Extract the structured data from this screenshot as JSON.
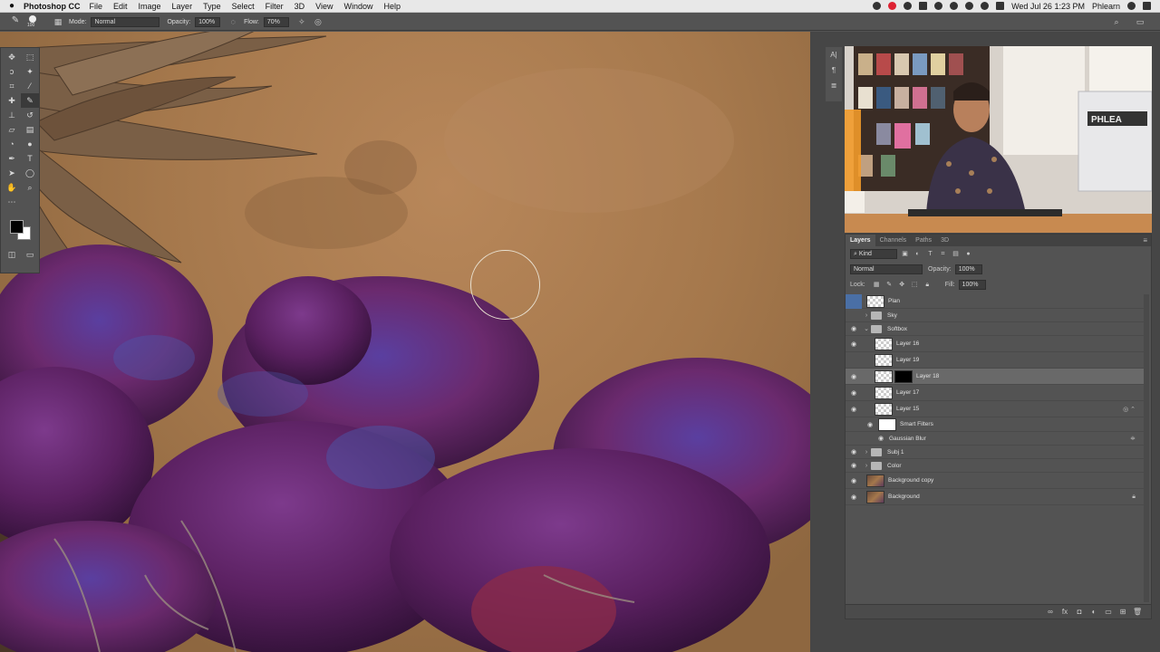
{
  "menubar": {
    "app_name": "Photoshop CC",
    "menus": [
      "File",
      "Edit",
      "Image",
      "Layer",
      "Type",
      "Select",
      "Filter",
      "3D",
      "View",
      "Window",
      "Help"
    ],
    "clock": "Wed Jul 26  1:23 PM",
    "user": "Phlearn"
  },
  "options": {
    "brush_size": "100",
    "mode_label": "Mode:",
    "mode_value": "Normal",
    "opacity_label": "Opacity:",
    "opacity_value": "100%",
    "flow_label": "Flow:",
    "flow_value": "70%"
  },
  "video": {
    "sign_text": "PHLEA"
  },
  "layers_panel": {
    "tabs": [
      "Layers",
      "Channels",
      "Paths",
      "3D"
    ],
    "filter_kind": "Kind",
    "blend_mode": "Normal",
    "opacity_label": "Opacity:",
    "opacity_value": "100%",
    "lock_label": "Lock:",
    "fill_label": "Fill:",
    "fill_value": "100%",
    "layers": [
      {
        "name": "Plan"
      },
      {
        "name": "Sky"
      },
      {
        "name": "Softbox"
      },
      {
        "name": "Layer 16"
      },
      {
        "name": "Layer 19"
      },
      {
        "name": "Layer 18"
      },
      {
        "name": "Layer 17"
      },
      {
        "name": "Layer 15"
      },
      {
        "name": "Smart Filters"
      },
      {
        "name": "Gaussian Blur"
      },
      {
        "name": "Subj 1"
      },
      {
        "name": "Color"
      },
      {
        "name": "Background copy"
      },
      {
        "name": "Background"
      }
    ]
  },
  "colors": {
    "accent": "#4a6fa5",
    "canvas_ground": "#a5784c",
    "tree_purple": "#6b2a6e"
  }
}
